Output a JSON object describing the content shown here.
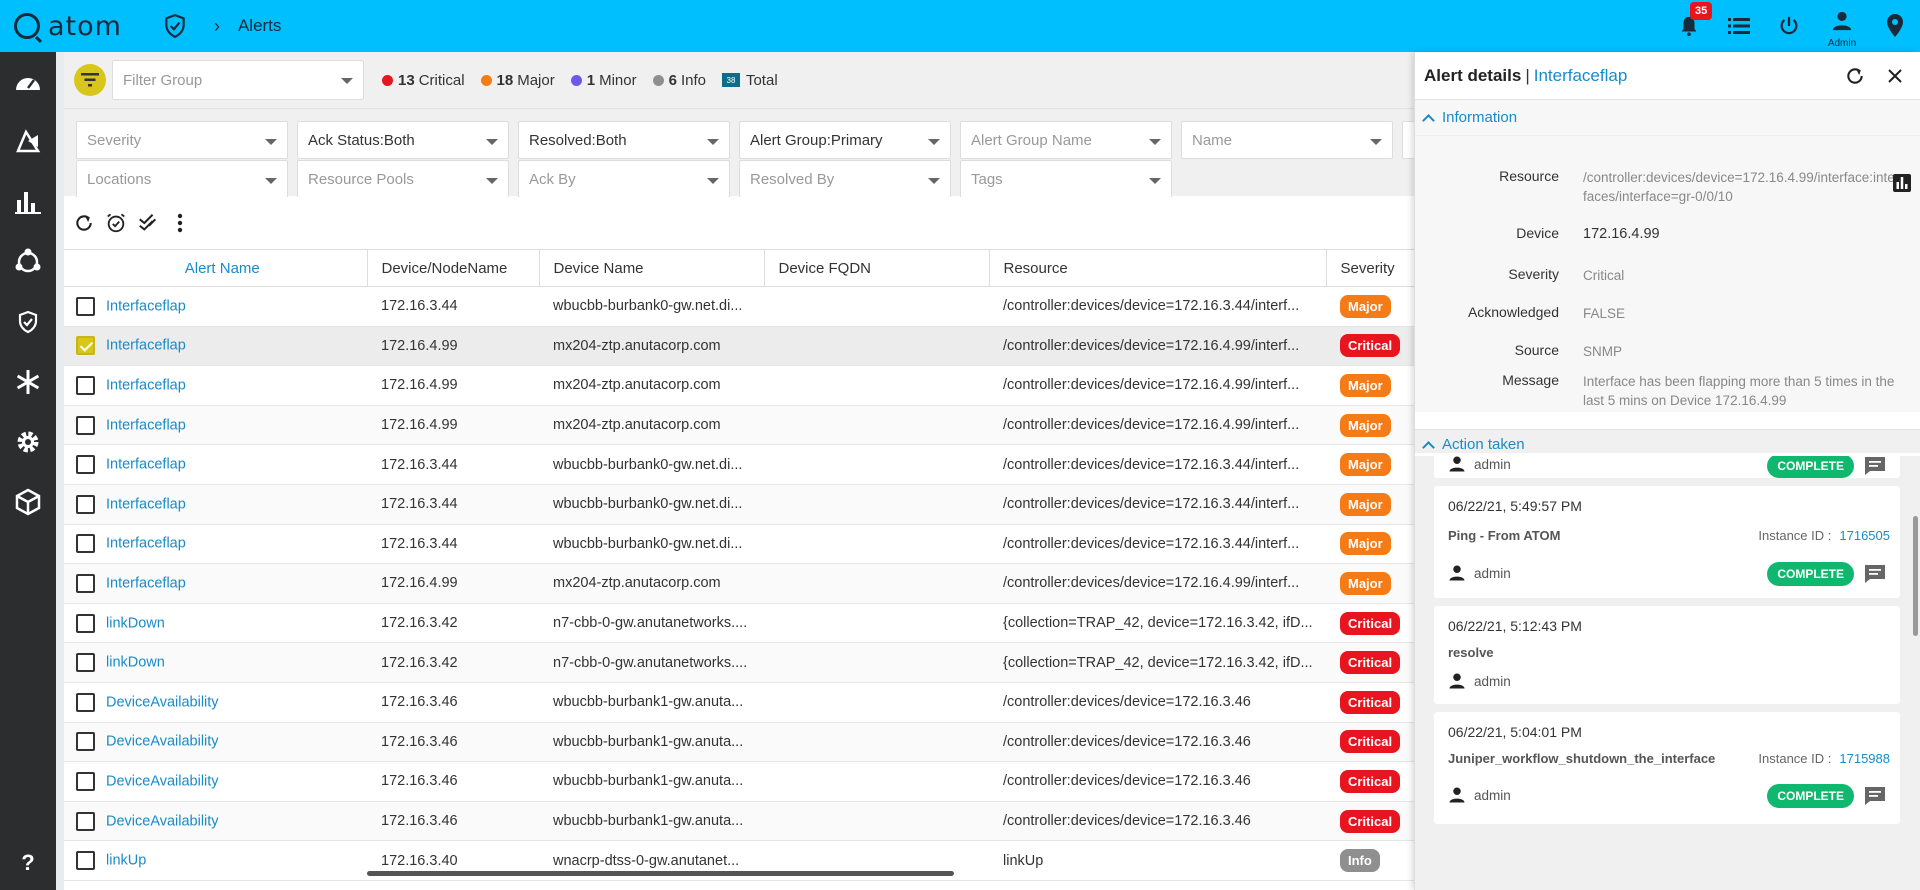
{
  "app": {
    "logo_text": "atom",
    "page_title": "Alerts"
  },
  "topbar": {
    "notifications_count": "35",
    "user_label": "Admin"
  },
  "summary": {
    "filter_group_placeholder": "Filter Group",
    "critical_count": "13",
    "critical_label": "Critical",
    "major_count": "18",
    "major_label": "Major",
    "minor_count": "1",
    "minor_label": "Minor",
    "info_count": "6",
    "info_label": "Info",
    "total_count": "38",
    "total_label": "Total",
    "colors": {
      "critical": "#e8151f",
      "major": "#f47b16",
      "minor": "#6a5ae8",
      "info": "#8f8f8f"
    }
  },
  "filters": {
    "severity": "Severity",
    "ack_status": "Ack Status:Both",
    "resolved": "Resolved:Both",
    "alert_group": "Alert Group:Primary",
    "alert_group_name": "Alert Group Name",
    "name": "Name",
    "locations": "Locations",
    "resource_pools": "Resource Pools",
    "ack_by": "Ack By",
    "resolved_by": "Resolved By",
    "tags": "Tags"
  },
  "table": {
    "columns": [
      "Alert Name",
      "Device/NodeName",
      "Device Name",
      "Device FQDN",
      "Resource",
      "Severity"
    ],
    "rows": [
      {
        "name": "Interfaceflap",
        "node": "172.16.3.44",
        "device": "wbucbb-burbank0-gw.net.di...",
        "fqdn": "",
        "resource": "/controller:devices/device=172.16.3.44/interf...",
        "severity": "Major",
        "checked": false
      },
      {
        "name": "Interfaceflap",
        "node": "172.16.4.99",
        "device": "mx204-ztp.anutacorp.com",
        "fqdn": "",
        "resource": "/controller:devices/device=172.16.4.99/interf...",
        "severity": "Critical",
        "checked": true
      },
      {
        "name": "Interfaceflap",
        "node": "172.16.4.99",
        "device": "mx204-ztp.anutacorp.com",
        "fqdn": "",
        "resource": "/controller:devices/device=172.16.4.99/interf...",
        "severity": "Major",
        "checked": false
      },
      {
        "name": "Interfaceflap",
        "node": "172.16.4.99",
        "device": "mx204-ztp.anutacorp.com",
        "fqdn": "",
        "resource": "/controller:devices/device=172.16.4.99/interf...",
        "severity": "Major",
        "checked": false
      },
      {
        "name": "Interfaceflap",
        "node": "172.16.3.44",
        "device": "wbucbb-burbank0-gw.net.di...",
        "fqdn": "",
        "resource": "/controller:devices/device=172.16.3.44/interf...",
        "severity": "Major",
        "checked": false
      },
      {
        "name": "Interfaceflap",
        "node": "172.16.3.44",
        "device": "wbucbb-burbank0-gw.net.di...",
        "fqdn": "",
        "resource": "/controller:devices/device=172.16.3.44/interf...",
        "severity": "Major",
        "checked": false
      },
      {
        "name": "Interfaceflap",
        "node": "172.16.3.44",
        "device": "wbucbb-burbank0-gw.net.di...",
        "fqdn": "",
        "resource": "/controller:devices/device=172.16.3.44/interf...",
        "severity": "Major",
        "checked": false
      },
      {
        "name": "Interfaceflap",
        "node": "172.16.4.99",
        "device": "mx204-ztp.anutacorp.com",
        "fqdn": "",
        "resource": "/controller:devices/device=172.16.4.99/interf...",
        "severity": "Major",
        "checked": false
      },
      {
        "name": "linkDown",
        "node": "172.16.3.42",
        "device": "n7-cbb-0-gw.anutanetworks....",
        "fqdn": "",
        "resource": "{collection=TRAP_42, device=172.16.3.42, ifD...",
        "severity": "Critical",
        "checked": false
      },
      {
        "name": "linkDown",
        "node": "172.16.3.42",
        "device": "n7-cbb-0-gw.anutanetworks....",
        "fqdn": "",
        "resource": "{collection=TRAP_42, device=172.16.3.42, ifD...",
        "severity": "Critical",
        "checked": false
      },
      {
        "name": "DeviceAvailability",
        "node": "172.16.3.46",
        "device": "wbucbb-burbank1-gw.anuta...",
        "fqdn": "",
        "resource": "/controller:devices/device=172.16.3.46",
        "severity": "Critical",
        "checked": false
      },
      {
        "name": "DeviceAvailability",
        "node": "172.16.3.46",
        "device": "wbucbb-burbank1-gw.anuta...",
        "fqdn": "",
        "resource": "/controller:devices/device=172.16.3.46",
        "severity": "Critical",
        "checked": false
      },
      {
        "name": "DeviceAvailability",
        "node": "172.16.3.46",
        "device": "wbucbb-burbank1-gw.anuta...",
        "fqdn": "",
        "resource": "/controller:devices/device=172.16.3.46",
        "severity": "Critical",
        "checked": false
      },
      {
        "name": "DeviceAvailability",
        "node": "172.16.3.46",
        "device": "wbucbb-burbank1-gw.anuta...",
        "fqdn": "",
        "resource": "/controller:devices/device=172.16.3.46",
        "severity": "Critical",
        "checked": false
      },
      {
        "name": "linkUp",
        "node": "172.16.3.40",
        "device": "wnacrp-dtss-0-gw.anutanet...",
        "fqdn": "",
        "resource": "linkUp",
        "severity": "Info",
        "checked": false
      }
    ]
  },
  "panel": {
    "title": "Alert details",
    "separator": "|",
    "subtitle": "Interfaceflap",
    "info_section": "Information",
    "info": {
      "resource_label": "Resource",
      "resource": "/controller:devices/device=172.16.4.99/interface:interfaces/interface=gr-0/0/10",
      "device_label": "Device",
      "device": "172.16.4.99",
      "severity_label": "Severity",
      "severity": "Critical",
      "ack_label": "Acknowledged",
      "ack": "FALSE",
      "source_label": "Source",
      "source": "SNMP",
      "message_label": "Message",
      "message": "Interface has been flapping more than 5 times in the last 5 mins on Device 172.16.4.99"
    },
    "actions_section": "Action taken",
    "partial_card": {
      "user": "admin",
      "status": "COMPLETE"
    },
    "actions": [
      {
        "time": "06/22/21, 5:49:57 PM",
        "task": "Ping - From ATOM",
        "instance_label": "Instance ID :",
        "instance_id": "1716505",
        "user": "admin",
        "status": "COMPLETE"
      },
      {
        "time": "06/22/21, 5:12:43 PM",
        "task": "resolve",
        "user": "admin"
      },
      {
        "time": "06/22/21, 5:04:01 PM",
        "task": "Juniper_workflow_shutdown_the_interface",
        "instance_label": "Instance ID :",
        "instance_id": "1715988",
        "user": "admin",
        "status": "COMPLETE"
      }
    ]
  }
}
